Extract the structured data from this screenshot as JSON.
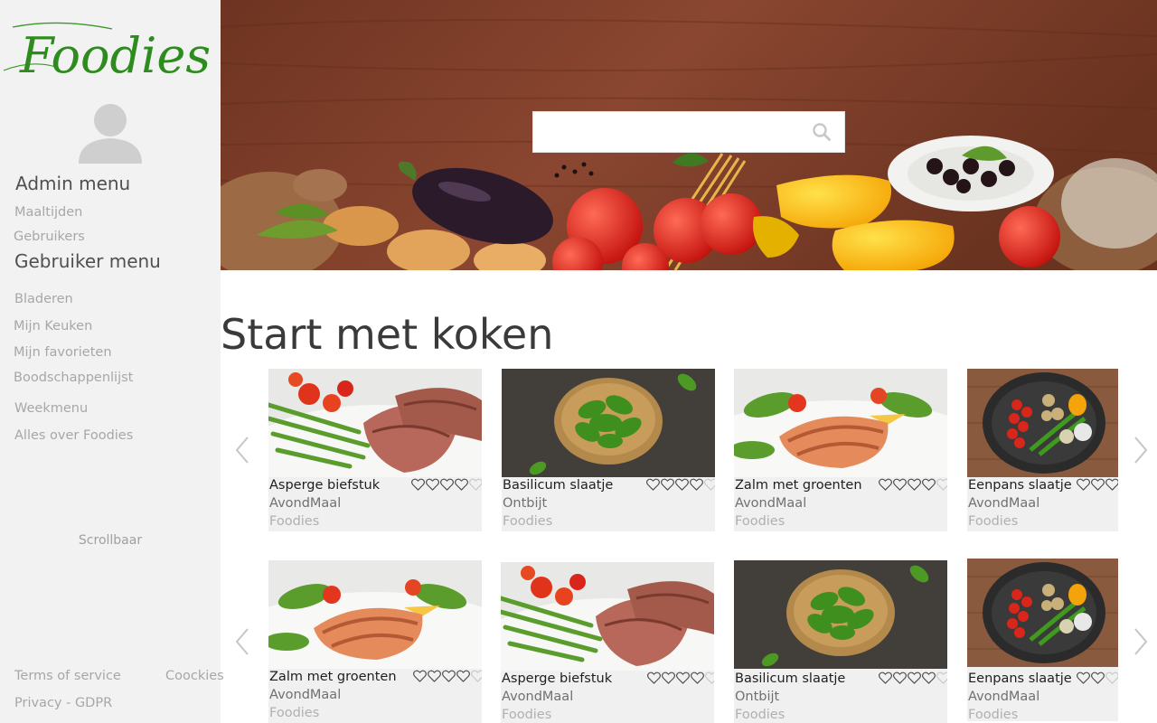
{
  "brand": {
    "logo_text": "Foodies"
  },
  "sidebar": {
    "admin_heading": "Admin menu",
    "admin_items": [
      {
        "label": "Maaltijden"
      },
      {
        "label": "Gebruikers"
      }
    ],
    "user_heading": "Gebruiker menu",
    "user_items": [
      {
        "label": "Bladeren"
      },
      {
        "label": "Mijn Keuken"
      },
      {
        "label": "Mijn favorieten"
      },
      {
        "label": "Boodschappenlijst"
      },
      {
        "label": "Weekmenu"
      },
      {
        "label": "Alles over Foodies"
      }
    ],
    "scroll_note": "Scrollbaar",
    "footer": {
      "terms": "Terms of service",
      "cookies": "Coockies",
      "privacy": "Privacy - GDPR"
    }
  },
  "search": {
    "value": "",
    "placeholder": ""
  },
  "main": {
    "title": "Start met koken",
    "rows": [
      {
        "cards": [
          {
            "title": "Asperge biefstuk",
            "category": "AvondMaal",
            "source": "Foodies",
            "rating": 4,
            "max": 5
          },
          {
            "title": "Basilicum slaatje",
            "category": "Ontbijt",
            "source": "Foodies",
            "rating": 4,
            "max": 5
          },
          {
            "title": "Zalm met groenten",
            "category": "AvondMaal",
            "source": "Foodies",
            "rating": 4,
            "max": 5
          },
          {
            "title": "Eenpans slaatje",
            "category": "AvondMaal",
            "source": "Foodies",
            "rating": 3,
            "max": 3
          }
        ]
      },
      {
        "cards": [
          {
            "title": "Zalm met groenten",
            "category": "AvondMaal",
            "source": "Foodies",
            "rating": 4,
            "max": 5
          },
          {
            "title": "Asperge biefstuk",
            "category": "AvondMaal",
            "source": "Foodies",
            "rating": 4,
            "max": 5
          },
          {
            "title": "Basilicum slaatje",
            "category": "Ontbijt",
            "source": "Foodies",
            "rating": 4,
            "max": 5
          },
          {
            "title": "Eenpans slaatje",
            "category": "AvondMaal",
            "source": "Foodies",
            "rating": 2,
            "max": 3
          }
        ]
      }
    ]
  },
  "colors": {
    "sidebar_bg": "#f2f2f2",
    "logo_green": "#2e8b1e",
    "card_bg": "#f0f0f0",
    "wood": "#7a3a22"
  },
  "icons": {
    "search": "search-icon",
    "prev": "chevron-left-icon",
    "next": "chevron-right-icon",
    "avatar": "user-avatar-icon",
    "rating": "heart-icon"
  }
}
